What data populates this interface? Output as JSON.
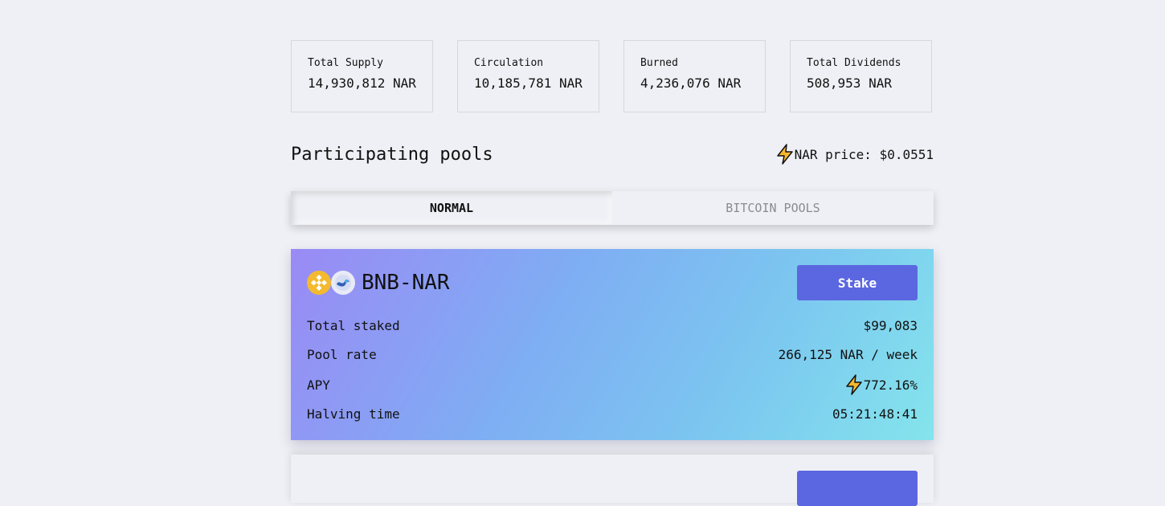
{
  "stats": [
    {
      "label": "Total Supply",
      "value": "14,930,812 NAR"
    },
    {
      "label": "Circulation",
      "value": "10,185,781 NAR"
    },
    {
      "label": "Burned",
      "value": "4,236,076 NAR"
    },
    {
      "label": "Total Dividends",
      "value": "508,953 NAR"
    }
  ],
  "pools_title": "Participating pools",
  "nar_price": "NAR price: $0.0551",
  "tabs": [
    {
      "label": "NORMAL",
      "active": true
    },
    {
      "label": "BITCOIN POOLS",
      "active": false
    }
  ],
  "pool": {
    "name": "BNB-NAR",
    "stake_label": "Stake",
    "icons": [
      "bnb-icon",
      "nar-icon"
    ],
    "rows": [
      {
        "label": "Total staked",
        "value": "$99,083"
      },
      {
        "label": "Pool rate",
        "value": "266,125 NAR / week"
      },
      {
        "label": "APY",
        "value": "772.16%"
      },
      {
        "label": "Halving time",
        "value": "05:21:48:41"
      }
    ]
  },
  "colors": {
    "background": "#eff0f5",
    "button": "#5b67e0",
    "bolt": "#f5b82e",
    "bnb": "#f3ba2f"
  }
}
